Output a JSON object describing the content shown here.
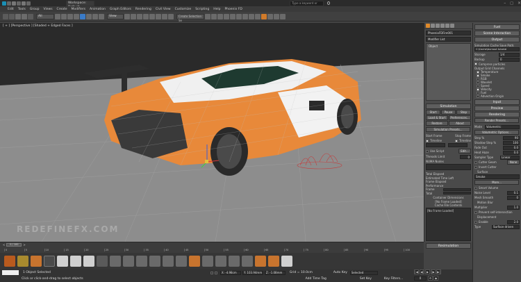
{
  "titlebar": {
    "workspace": "Workspace: Default",
    "search_placeholder": "Type a keyword or phrase"
  },
  "menu": {
    "items": [
      "Edit",
      "Tools",
      "Group",
      "Views",
      "Create",
      "Modifiers",
      "Animation",
      "Graph Editors",
      "Rendering",
      "Civil View",
      "Customize",
      "Scripting",
      "Help",
      "Phoenix FD"
    ]
  },
  "toolbar": {
    "filter": "All",
    "view": "View",
    "selection_set": "Create Selection Se"
  },
  "viewport": {
    "label": "[ + ] [Perspective ] [Shaded + Edged Faces ]",
    "watermark": "REDEFINEFX.COM"
  },
  "cmd": {
    "object_name": "PhoenixFDFire001",
    "modifier_list": "Modifier List",
    "stack_item": "Object",
    "simulation_header": "Simulation",
    "sim_buttons": [
      "Start",
      "Pause",
      "Stop"
    ],
    "load_start": "Load & Start",
    "preferences": "Preferences...",
    "restore": "Restore",
    "about": "About",
    "presets": "Simulation Presets...",
    "start_frame": "Start Frame",
    "stop_frame": "Stop Frame",
    "timeline": "Timeline",
    "use_script": "Use Script",
    "edit": "Edit...",
    "threads_limit": "Threads Limit",
    "threads_value": "0",
    "numa": "NUMA Nodes",
    "total_elapsed": "Total Elapsed",
    "est_time_left": "Estimated Time Left",
    "frame_elapsed": "Frame Elapsed",
    "performance": "Performance",
    "frame": "Frame",
    "total": "Total",
    "container_dims": "Container Dimensions",
    "no_frame": "[No Frame Loaded]",
    "cache_contents": "Cache File Contents",
    "cache_box": "[No Frame Loaded]",
    "resimulation": "Resimulation"
  },
  "rp": {
    "fuel": "Fuel",
    "scene_interaction": "Scene Interaction",
    "output": "Output",
    "cache_path_label": "Simulation Cache Save Path:",
    "cache_path": "C:\\Cache\\burnout tutorial",
    "storage": "Storage",
    "storage_val": "1/4",
    "backup": "Backup",
    "backup_val": "0",
    "compress": "Compress particles",
    "grid_channels": "Output Grid Channels",
    "channels": [
      {
        "label": "Temperature",
        "checked": true
      },
      {
        "label": "Smoke",
        "checked": true
      },
      {
        "label": "RGB",
        "checked": false
      },
      {
        "label": "Wavelet",
        "checked": false
      },
      {
        "label": "Speed",
        "checked": false
      },
      {
        "label": "Velocity",
        "checked": true
      },
      {
        "label": "Fuel",
        "checked": false
      },
      {
        "label": "Advection Origin",
        "checked": false
      }
    ],
    "input": "Input",
    "preview": "Preview",
    "rendering": "Rendering",
    "render_presets": "Render Presets...",
    "mode": "Mode",
    "mode_val": "Volumetric",
    "volumetric_options": "Volumetric Options...",
    "step": "Step %",
    "step_val": "90",
    "shadow_step": "Shadow Step %",
    "shadow_step_val": "100",
    "fade_out": "Fade Out",
    "fade_out_val": "0.0",
    "heat_haze": "Heat Haze",
    "heat_haze_val": "0.0",
    "sampler": "Sampler Type",
    "sampler_val": "Linear",
    "cutter_geom": "Cutter Geom",
    "none": "None",
    "invert_cutter": "Invert Cutter",
    "surface": "Surface",
    "surface_val": "Smoke",
    "more": "More...",
    "smart_volume": "Smart Volume",
    "noise_level": "Noise Level",
    "noise_val": "0.1",
    "mesh_smooth": "Mesh Smooth",
    "mesh_val": "0",
    "motion_blur": "Motion Blur",
    "multiplier": "Multiplier",
    "multiplier_val": "1.0",
    "prevent_self": "Prevent self-intersection",
    "displacement": "Displacement",
    "enable": "Enable",
    "map_val": "2.0",
    "type": "Type",
    "type_val": "Surface driven"
  },
  "timeline": {
    "frame": "0 / 100",
    "ticks": [
      "0",
      "5",
      "10",
      "15",
      "20",
      "25",
      "30",
      "35",
      "40",
      "45",
      "50",
      "55",
      "60",
      "65",
      "70",
      "75",
      "80",
      "85",
      "90",
      "95",
      "100"
    ]
  },
  "status": {
    "selection": "1 Object Selected",
    "prompt": "Click or click-and-drag to select objects",
    "x": "X: -4.98cm",
    "y": "Y: 103.94mm",
    "z": "Z: -1.08mm",
    "grid": "Grid = 10.0cm",
    "add_time_tag": "Add Time Tag",
    "set_key": "Set Key",
    "auto_key": "Auto Key",
    "selected": "Selected",
    "key_filters": "Key Filters...",
    "frame_val": "0"
  },
  "colors": {
    "accent": "#e07a1e",
    "car_orange": "#e8893a",
    "ground": "#8d8d8d"
  }
}
